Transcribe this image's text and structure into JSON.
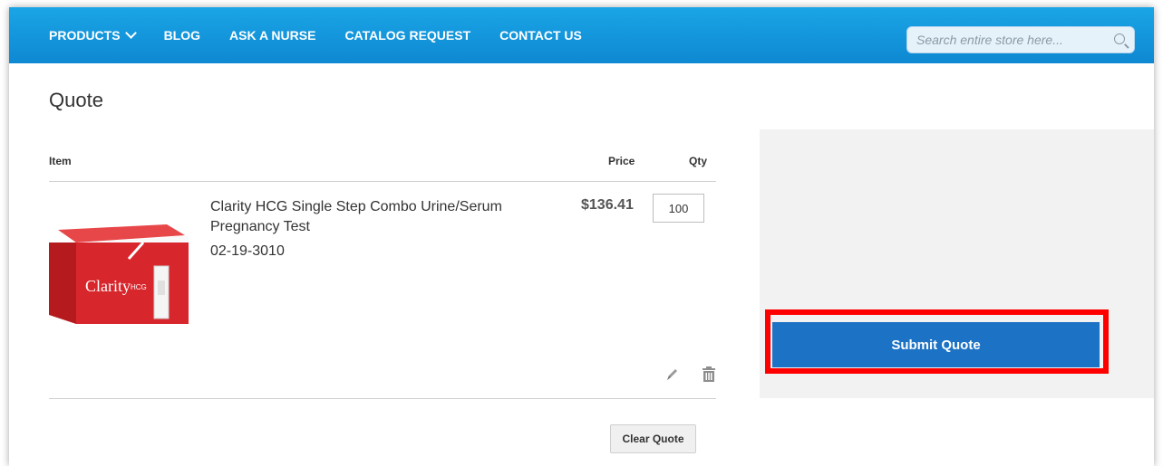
{
  "nav": {
    "items": [
      {
        "label": "PRODUCTS",
        "has_dropdown": true
      },
      {
        "label": "BLOG"
      },
      {
        "label": "ASK A NURSE"
      },
      {
        "label": "CATALOG REQUEST"
      },
      {
        "label": "CONTACT US"
      }
    ]
  },
  "search": {
    "placeholder": "Search entire store here...",
    "icon": "search-icon"
  },
  "page": {
    "title": "Quote"
  },
  "table": {
    "headers": {
      "item": "Item",
      "price": "Price",
      "qty": "Qty"
    },
    "rows": [
      {
        "name": "Clarity HCG Single Step Combo Urine/Serum Pregnancy Test",
        "sku": "02-19-3010",
        "price": "$136.41",
        "qty": "100",
        "image_brand": "Clarity",
        "image_sub": "HCG"
      }
    ]
  },
  "actions": {
    "clear": "Clear Quote",
    "submit": "Submit Quote"
  },
  "colors": {
    "topbar": "#0e88d2",
    "submit": "#1c72c4",
    "highlight": "#ff0000"
  }
}
